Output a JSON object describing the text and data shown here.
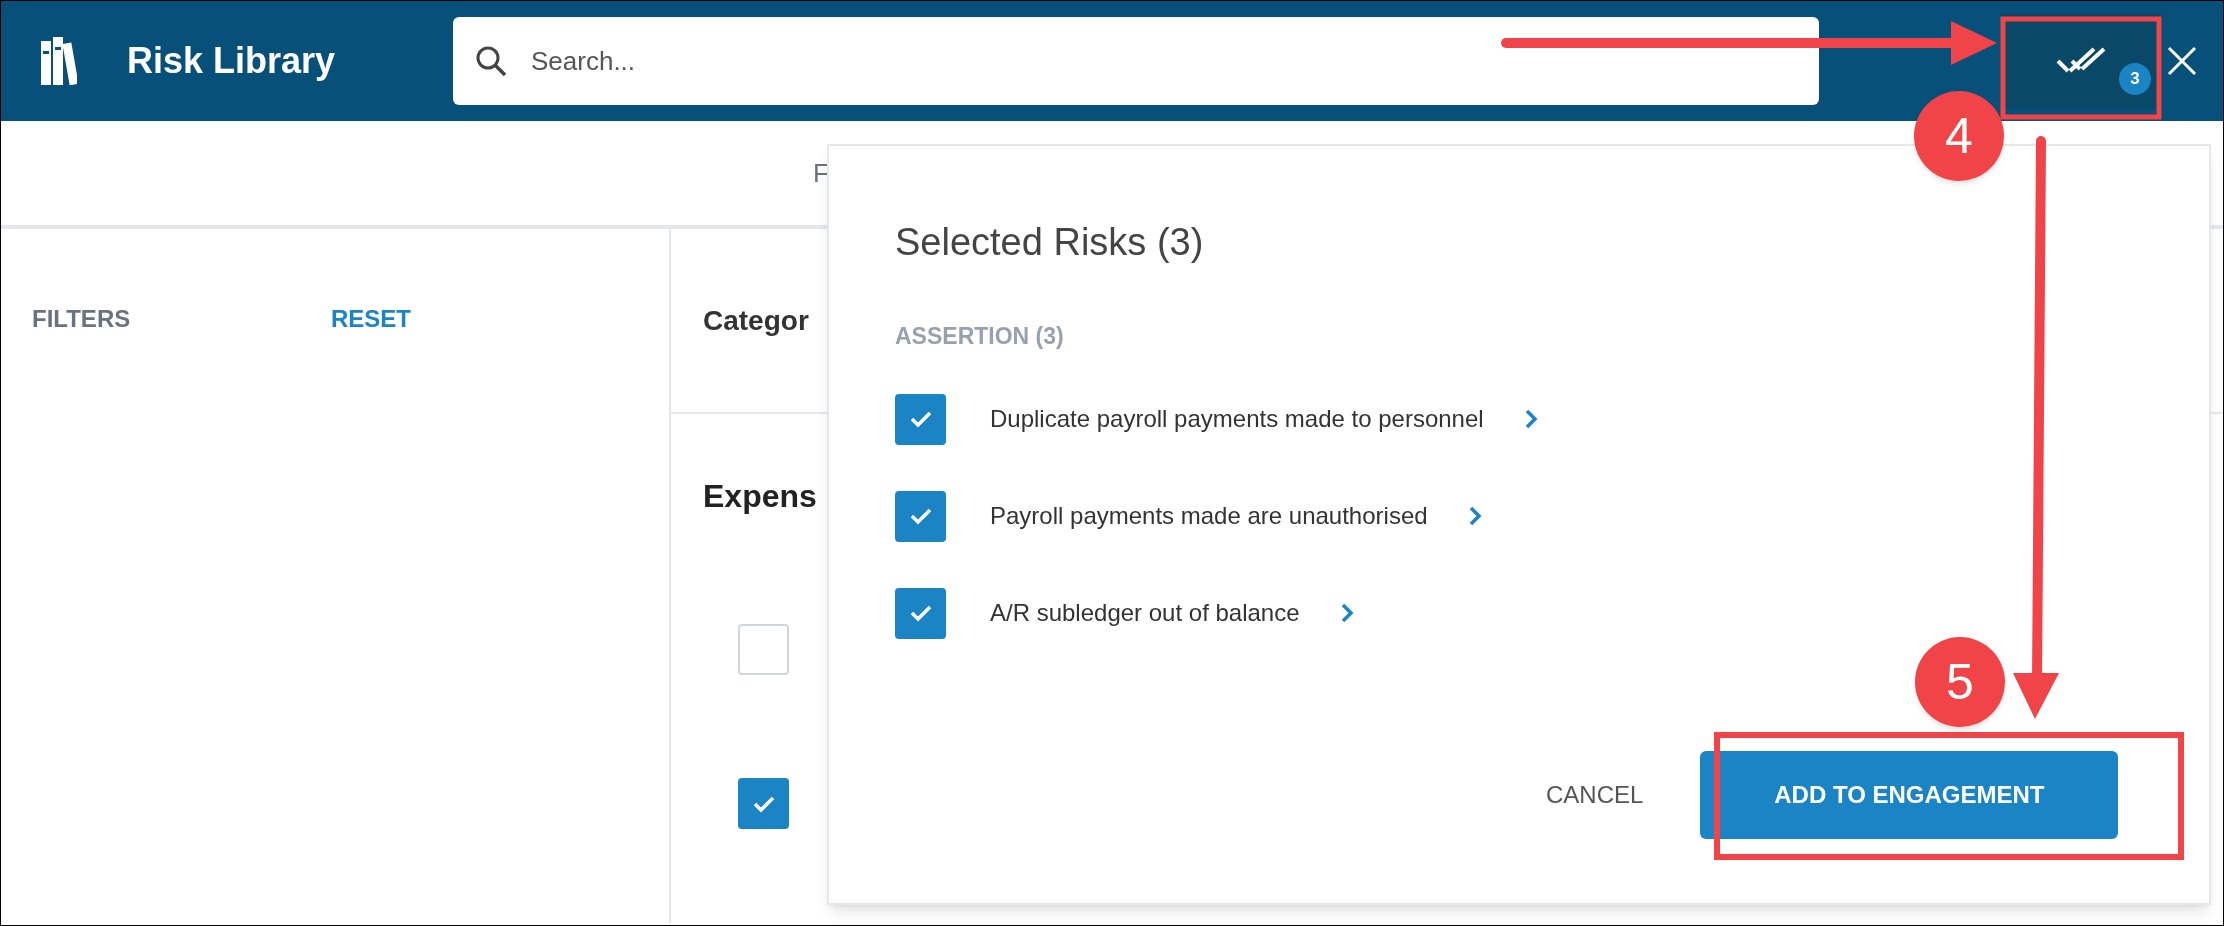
{
  "header": {
    "title": "Risk Library",
    "search": {
      "placeholder": "Search..."
    },
    "selected_count": "3"
  },
  "toolbar": {
    "label": "F"
  },
  "filters": {
    "title": "FILTERS",
    "reset": "RESET"
  },
  "content": {
    "heading": "Categor",
    "section": "Expens",
    "checkboxes": [
      {
        "checked": false
      },
      {
        "checked": true
      }
    ]
  },
  "popup": {
    "title": "Selected Risks (3)",
    "group": "ASSERTION (3)",
    "items": [
      {
        "label": "Duplicate payroll payments made to personnel",
        "checked": true
      },
      {
        "label": "Payroll payments made are unauthorised",
        "checked": true
      },
      {
        "label": "A/R subledger out of balance",
        "checked": true
      }
    ],
    "cancel": "CANCEL",
    "confirm": "ADD TO ENGAGEMENT"
  },
  "annotations": [
    {
      "number": "4"
    },
    {
      "number": "5"
    }
  ]
}
